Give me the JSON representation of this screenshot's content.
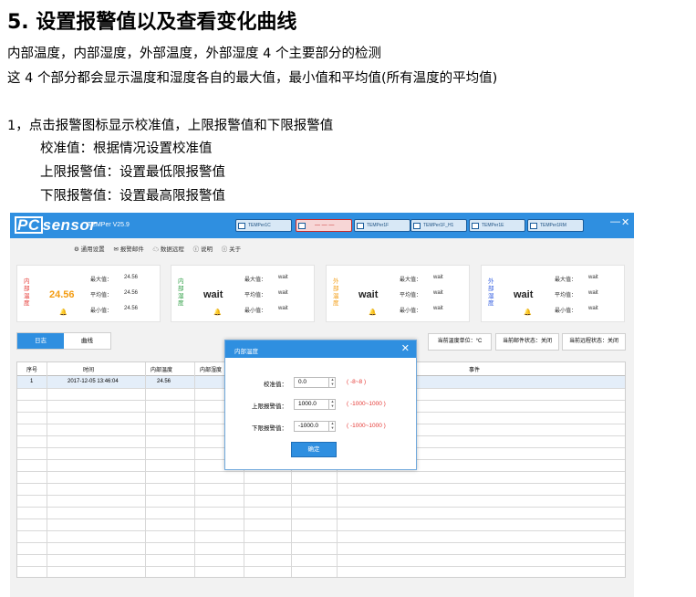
{
  "doc": {
    "title": "5. 设置报警值以及查看变化曲线",
    "lines": [
      "内部温度，内部湿度，外部温度，外部湿度  4 个主要部分的检测",
      "这 4 个部分都会显示温度和湿度各自的最大值，最小值和平均值(所有温度的平均值)",
      "1，点击报警图标显示校准值，上限报警值和下限报警值",
      "校准值：根据情况设置校准值",
      "上限报警值：设置最低限报警值",
      "下限报警值：设置最高限报警值"
    ]
  },
  "app": {
    "logo": "PCsensor",
    "name": "TEMPer V25.9",
    "devices": [
      "TEMPer1C",
      "",
      "TEMPer1F",
      "TEMPer1F_H1",
      "TEMPer1E",
      "TEMPer1RM"
    ],
    "active_device_text": "— — —",
    "menu": [
      "⚙ 通用设置",
      "✉ 报警邮件",
      "☁ 数据远程",
      "ⓘ 说明",
      "ⓘ 关于"
    ],
    "stat_labels": {
      "max": "最大值：",
      "avg": "平均值：",
      "min": "最小值："
    },
    "cards": [
      {
        "label": "内部温度",
        "value": "24.56",
        "max": "24.56",
        "avg": "24.56",
        "min": "24.56",
        "label_color": "#e53935",
        "value_color": "#f39c12"
      },
      {
        "label": "内部湿度",
        "value": "wait",
        "max": "wait",
        "avg": "wait",
        "min": "wait",
        "label_color": "#2e9e44",
        "value_color": "#222222"
      },
      {
        "label": "外部温度",
        "value": "wait",
        "max": "wait",
        "avg": "wait",
        "min": "wait",
        "label_color": "#f39c12",
        "value_color": "#222222"
      },
      {
        "label": "外部湿度",
        "value": "wait",
        "max": "wait",
        "avg": "wait",
        "min": "wait",
        "label_color": "#2f5be0",
        "value_color": "#222222"
      }
    ],
    "tabs": [
      "日志",
      "曲线"
    ],
    "status_buttons": [
      "当前温度单位：°C",
      "当前邮件状态：关闭",
      "当前远程状态：关闭"
    ],
    "table": {
      "headers": [
        "序号",
        "时间",
        "内部温度",
        "内部湿度",
        "事件"
      ],
      "rows": [
        {
          "index": "1",
          "time": "2017-12-05 13:46:04",
          "inner_temp": "24.56"
        }
      ]
    },
    "dialog": {
      "title": "内部温度",
      "fields": [
        {
          "label": "校准值：",
          "value": "0.0",
          "range": "( -8~8 )"
        },
        {
          "label": "上限报警值：",
          "value": "1000.0",
          "range": "( -1000~1000 )"
        },
        {
          "label": "下限报警值：",
          "value": "-1000.0",
          "range": "( -1000~1000 )"
        }
      ],
      "ok_label": "确定"
    }
  }
}
